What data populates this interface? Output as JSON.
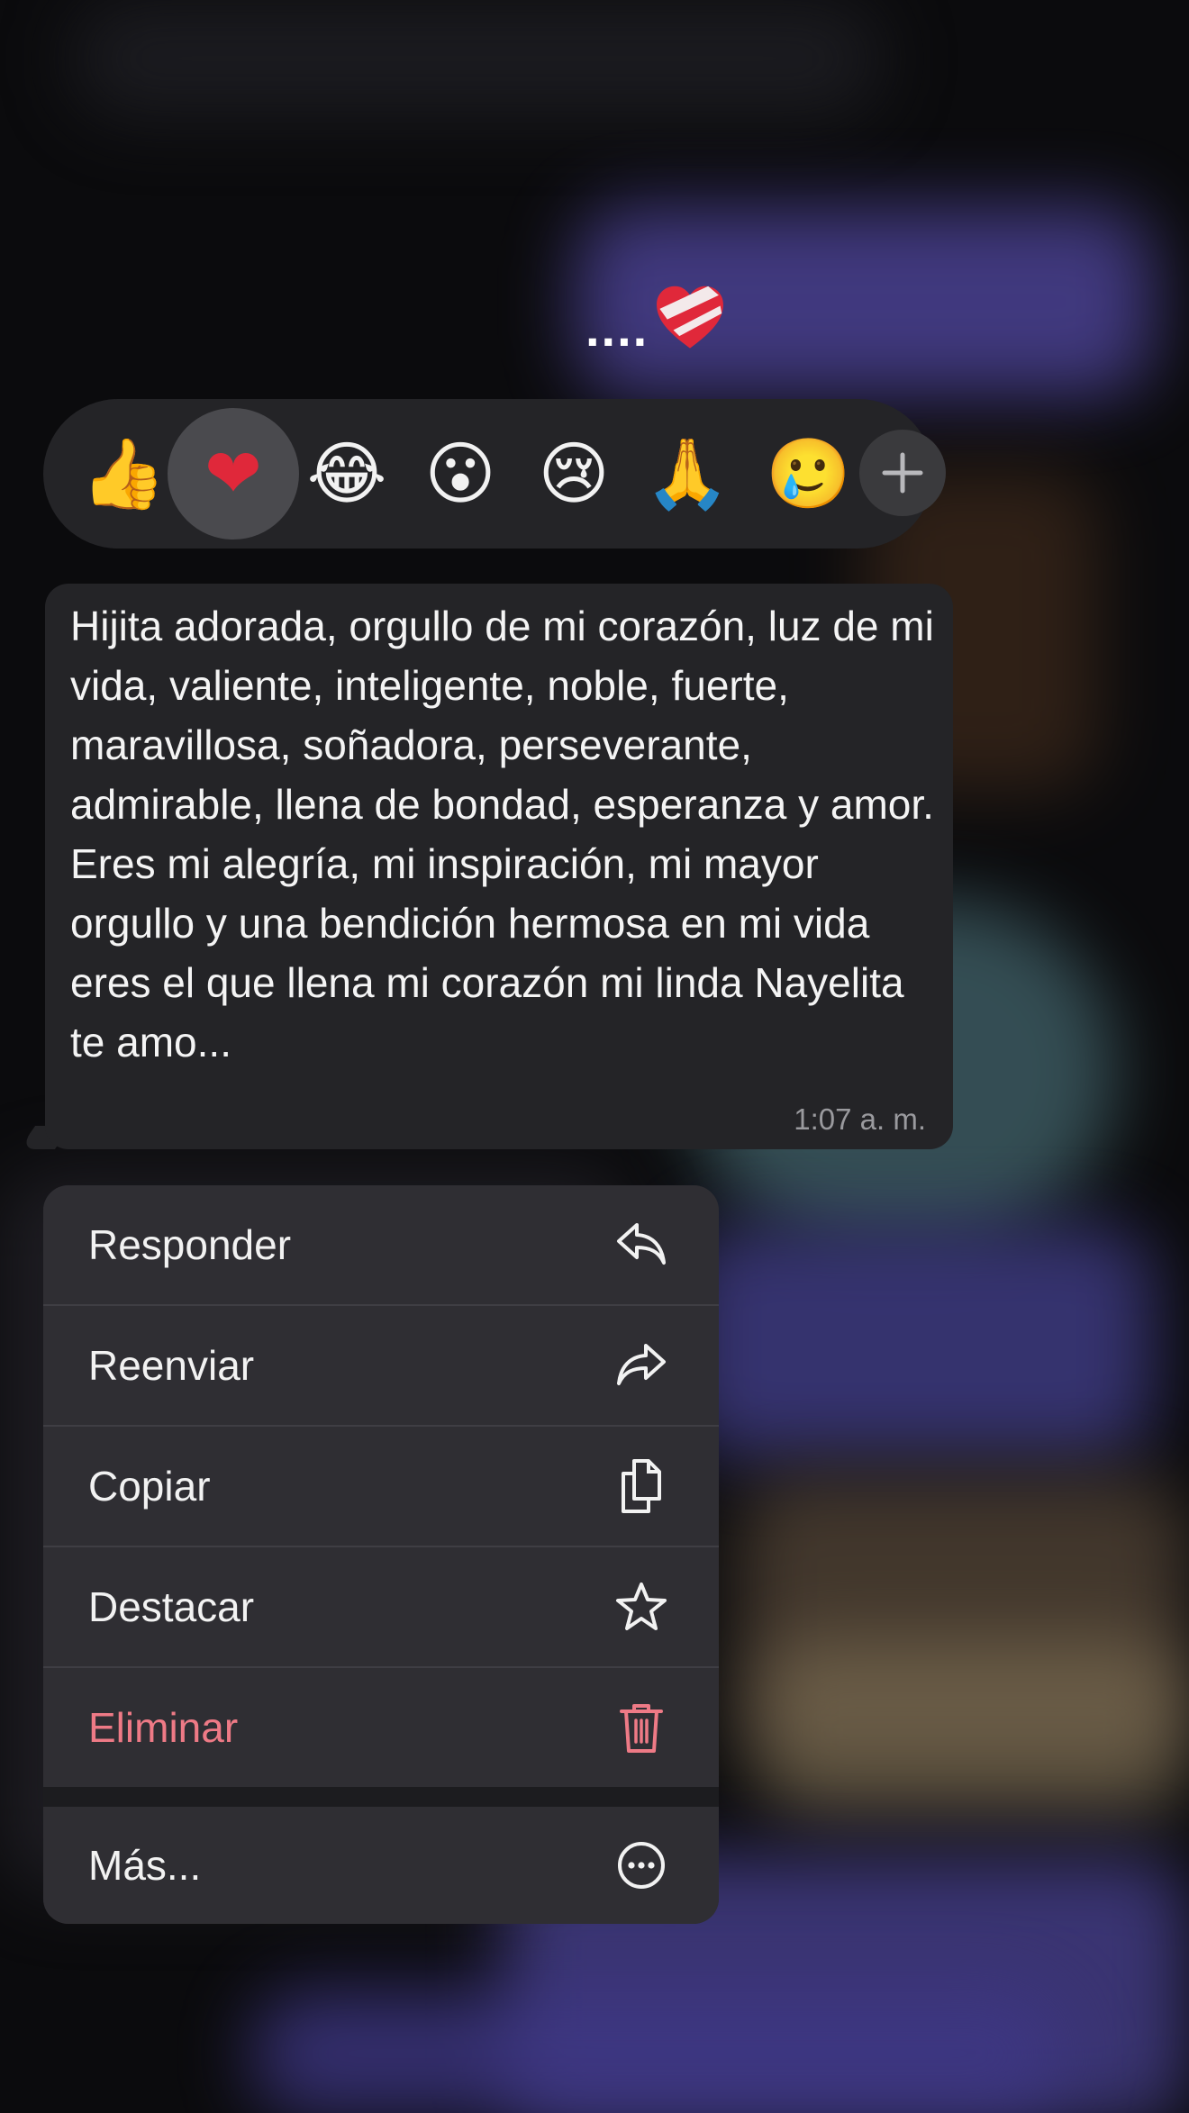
{
  "preview": {
    "text": "....",
    "icon": "mending-heart-icon"
  },
  "reactions": {
    "items": [
      {
        "emoji": "👍",
        "name": "thumbs-up"
      },
      {
        "emoji": "❤",
        "name": "red-heart"
      },
      {
        "emoji": "😂",
        "name": "tears-of-joy"
      },
      {
        "emoji": "😮",
        "name": "open-mouth"
      },
      {
        "emoji": "😢",
        "name": "crying"
      },
      {
        "emoji": "🙏",
        "name": "folded-hands"
      },
      {
        "emoji": "🥲",
        "name": "smiling-tear"
      }
    ],
    "selected": "red-heart",
    "more_icon": "plus-icon"
  },
  "message": {
    "text": "Hijita adorada, orgullo de mi corazón, luz de mi vida, valiente, inteligente, noble, fuerte, maravillosa, soñadora, perseverante, admirable, llena de bondad, esperanza y amor. Eres mi alegría, mi inspiración, mi mayor orgullo y una bendición hermosa en mi vida eres el que llena mi corazón mi linda Nayelita te amo...",
    "time": "1:07 a. m."
  },
  "menu": {
    "reply": {
      "label": "Responder",
      "icon": "reply-icon"
    },
    "forward": {
      "label": "Reenviar",
      "icon": "forward-icon"
    },
    "copy": {
      "label": "Copiar",
      "icon": "copy-icon"
    },
    "star": {
      "label": "Destacar",
      "icon": "star-icon"
    },
    "delete": {
      "label": "Eliminar",
      "icon": "trash-icon",
      "color": "#ee7a86"
    },
    "more": {
      "label": "Más...",
      "icon": "more-icon"
    }
  }
}
